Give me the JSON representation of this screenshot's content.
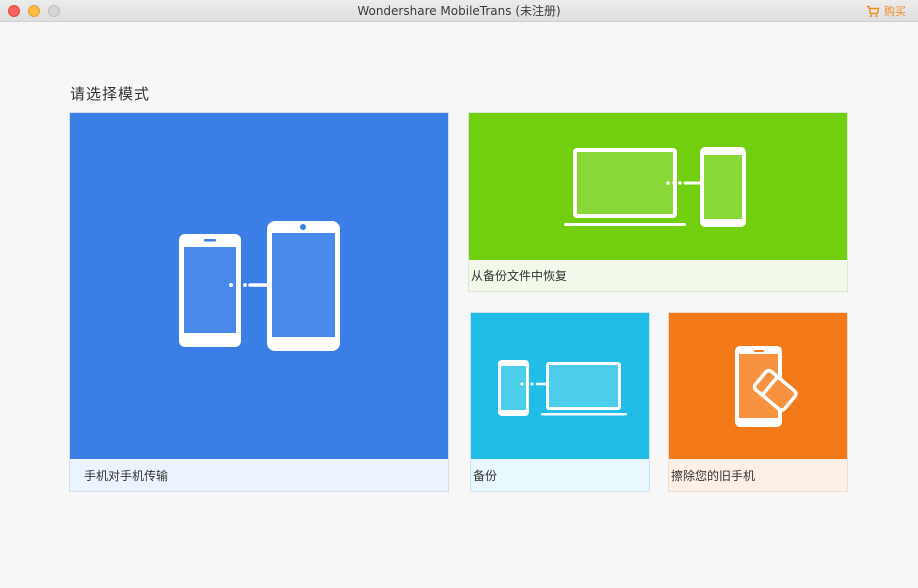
{
  "window": {
    "title": "Wondershare MobileTrans (未注册)",
    "buy_label": "购买"
  },
  "main": {
    "heading": "请选择模式",
    "cards": [
      {
        "id": "phone-to-phone",
        "label": "手机对手机传输",
        "color": "#3a7ee6",
        "icon": "phone-transfer-icon"
      },
      {
        "id": "restore-from-backup",
        "label": "从备份文件中恢复",
        "color": "#72cf0f",
        "icon": "laptop-to-phone-icon"
      },
      {
        "id": "backup",
        "label": "备份",
        "color": "#22bde6",
        "icon": "phone-to-laptop-icon"
      },
      {
        "id": "erase-old-phone",
        "label": "擦除您的旧手机",
        "color": "#f47a19",
        "icon": "phone-eraser-icon"
      }
    ]
  }
}
